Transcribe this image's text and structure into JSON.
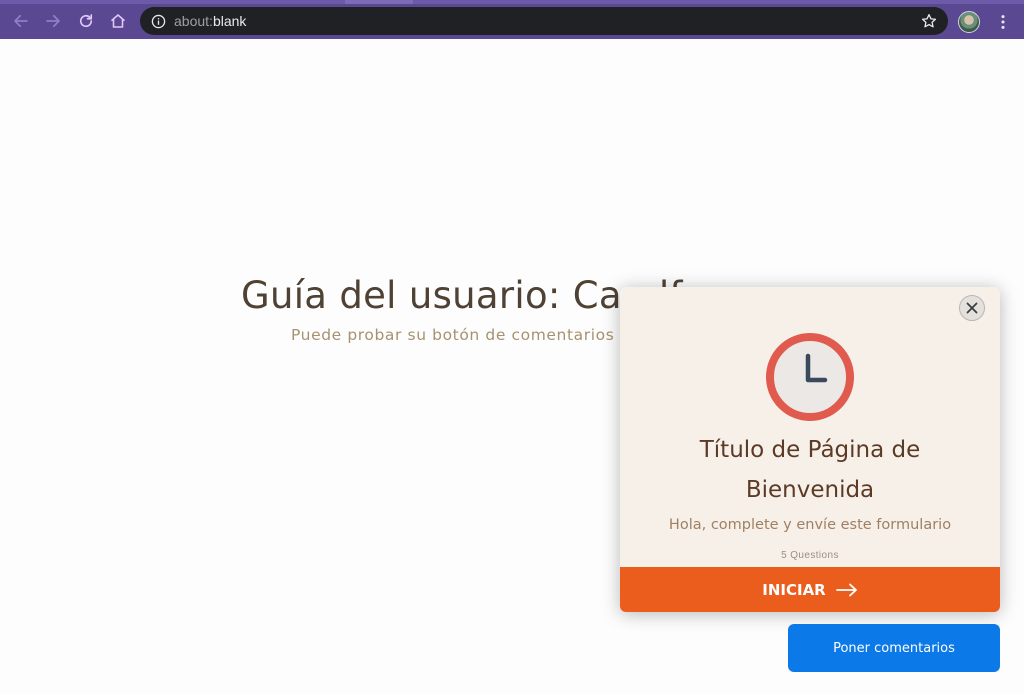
{
  "browser": {
    "url_scheme": "about:",
    "url_host": "blank",
    "colors": {
      "chrome": "#5a4892",
      "omnibox": "#202124"
    },
    "icons": [
      "back-icon",
      "forward-icon",
      "reload-icon",
      "home-icon",
      "info-icon",
      "star-icon",
      "avatar",
      "kebab-menu-icon"
    ]
  },
  "page": {
    "title": "Guía del usuario: Caudf",
    "subtitle": "Puede probar su botón de comentarios e"
  },
  "popup": {
    "title": "Título de Página de Bienvenida",
    "description": "Hola, complete y envíe este formulario",
    "question_count": "5 Questions",
    "start_label": "INICIAR",
    "colors": {
      "background": "#f7f0e9",
      "accent": "#eb5d1d",
      "clock_ring": "#e05a4d"
    }
  },
  "feedback": {
    "label": "Poner comentarios",
    "color": "#0c79e8"
  }
}
